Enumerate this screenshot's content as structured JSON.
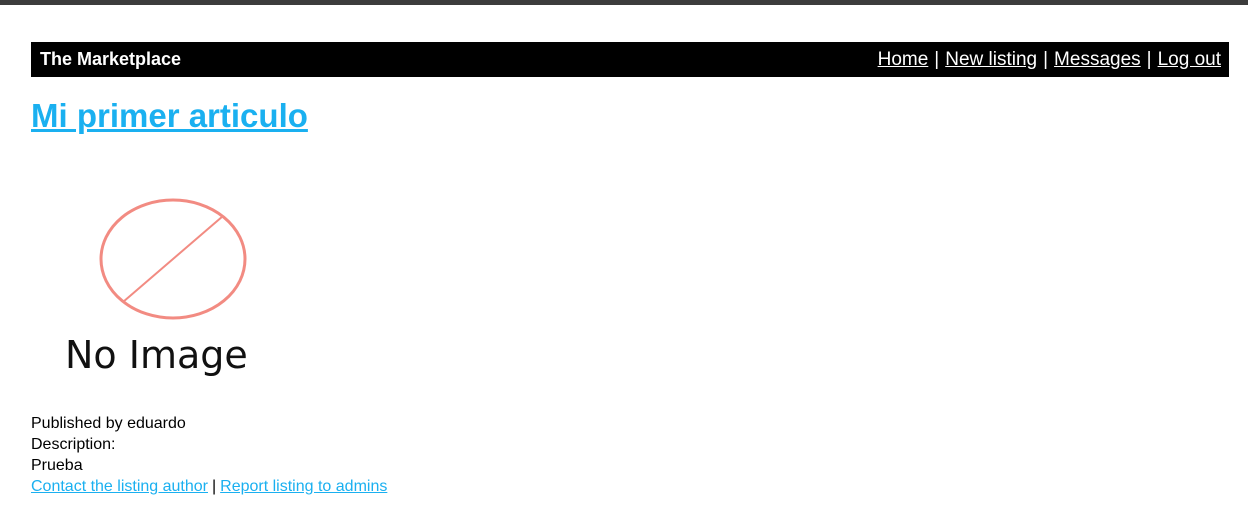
{
  "navbar": {
    "brand": "The Marketplace",
    "links": [
      "Home",
      "New listing",
      "Messages",
      "Log out"
    ],
    "separator": "|"
  },
  "listing": {
    "title": "Mi primer articulo",
    "image_placeholder_text": "No Image",
    "published_by": "Published by eduardo",
    "description_label": "Description:",
    "description": "Prueba",
    "contact_link": "Contact the listing author",
    "report_link": "Report listing to admins",
    "separator": "|"
  },
  "colors": {
    "link": "#1ab0f0",
    "navbar_bg": "#000000",
    "no_image_circle": "#f28b82"
  }
}
